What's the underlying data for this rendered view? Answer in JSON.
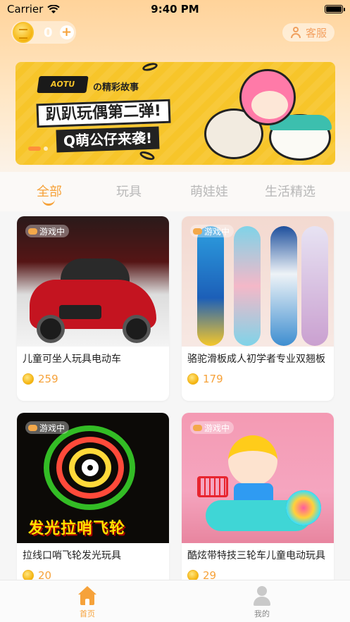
{
  "status_bar": {
    "carrier": "Carrier",
    "time": "9:40 PM"
  },
  "header": {
    "coin_count": "0",
    "plus": "+",
    "service_label": "客服"
  },
  "banner": {
    "logo_text": "AOTU",
    "subtitle": "の精彩故事",
    "title": "趴趴玩偶第二弹!",
    "title2": "Q萌公仔来袭!"
  },
  "tabs": [
    {
      "label": "全部",
      "active": true
    },
    {
      "label": "玩具",
      "active": false
    },
    {
      "label": "萌娃娃",
      "active": false
    },
    {
      "label": "生活精选",
      "active": false
    }
  ],
  "products": [
    {
      "badge": "游戏中",
      "title": "儿童可坐人玩具电动车",
      "price": "259"
    },
    {
      "badge": "游戏中",
      "title": "骆驼滑板成人初学者专业双翘板",
      "price": "179"
    },
    {
      "badge": "游戏中",
      "title": "拉线口哨飞轮发光玩具",
      "price": "20",
      "image_text": "发光拉哨飞轮"
    },
    {
      "badge": "游戏中",
      "title": "酷炫带特技三轮车儿童电动玩具",
      "price": "29"
    }
  ],
  "bottom_nav": [
    {
      "label": "首页",
      "active": true
    },
    {
      "label": "我的",
      "active": false
    }
  ],
  "colors": {
    "accent": "#f6a23a",
    "inactive": "#b8b8b8"
  }
}
